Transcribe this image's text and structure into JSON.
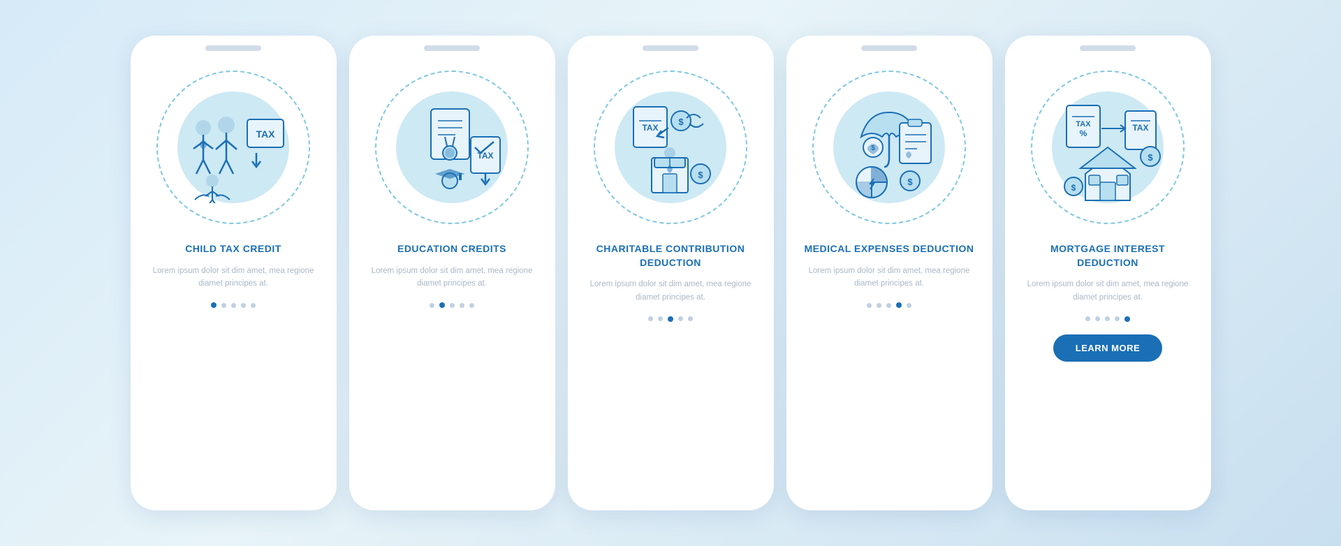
{
  "background": "#d6eaf8",
  "accent_color": "#1a6fb5",
  "cards": [
    {
      "id": "child-tax-credit",
      "title": "CHILD TAX CREDIT",
      "body": "Lorem ipsum dolor sit dim amet, mea regione diamet principes at.",
      "dots": [
        true,
        false,
        false,
        false,
        false
      ],
      "active_dot": 0,
      "show_button": false,
      "button_label": ""
    },
    {
      "id": "education-credits",
      "title": "EDUCATION CREDITS",
      "body": "Lorem ipsum dolor sit dim amet, mea regione diamet principes at.",
      "dots": [
        false,
        true,
        false,
        false,
        false
      ],
      "active_dot": 1,
      "show_button": false,
      "button_label": ""
    },
    {
      "id": "charitable-contribution",
      "title": "CHARITABLE CONTRIBUTION DEDUCTION",
      "body": "Lorem ipsum dolor sit dim amet, mea regione diamet principes at.",
      "dots": [
        false,
        false,
        true,
        false,
        false
      ],
      "active_dot": 2,
      "show_button": false,
      "button_label": ""
    },
    {
      "id": "medical-expenses",
      "title": "MEDICAL EXPENSES DEDUCTION",
      "body": "Lorem ipsum dolor sit dim amet, mea regione diamet principes at.",
      "dots": [
        false,
        false,
        false,
        true,
        false
      ],
      "active_dot": 3,
      "show_button": false,
      "button_label": ""
    },
    {
      "id": "mortgage-interest",
      "title": "MORTGAGE INTEREST DEDUCTION",
      "body": "Lorem ipsum dolor sit dim amet, mea regione diamet principes at.",
      "dots": [
        false,
        false,
        false,
        false,
        true
      ],
      "active_dot": 4,
      "show_button": true,
      "button_label": "LEARN MORE"
    }
  ]
}
